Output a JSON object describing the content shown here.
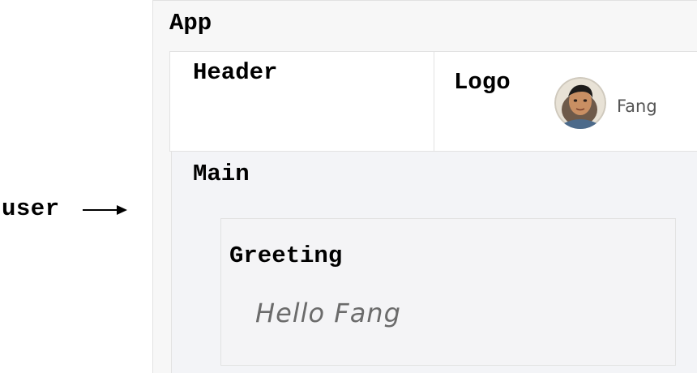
{
  "external": {
    "input_label": "user"
  },
  "components": {
    "app": {
      "label": "App"
    },
    "header": {
      "label": "Header"
    },
    "logo": {
      "label": "Logo",
      "avatar_name": "Fang"
    },
    "main": {
      "label": "Main"
    },
    "greeting": {
      "label": "Greeting",
      "text": "Hello Fang"
    }
  },
  "colors": {
    "app_bg": "#f7f7f7",
    "header_bg": "#ffffff",
    "main_bg": "#f3f4f7",
    "border": "#e2e2e2",
    "greeting_text": "#6b6b6b",
    "avatar_name": "#555555"
  },
  "icons": {
    "arrow": "right-arrow-icon",
    "avatar": "user-avatar"
  }
}
